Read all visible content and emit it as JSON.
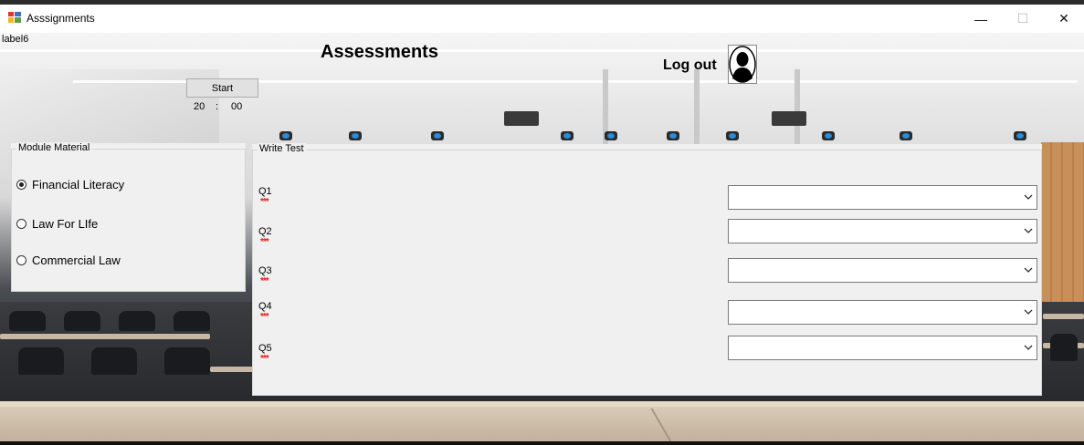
{
  "window": {
    "title": "Asssignments",
    "minimize_glyph": "—",
    "maximize_glyph": "☐",
    "close_glyph": "✕"
  },
  "label6": "label6",
  "heading": "Assessments",
  "logout": {
    "label": "Log out",
    "icon": "user-silhouette-icon"
  },
  "timer": {
    "start_label": "Start",
    "minutes": "20",
    "separator": ":",
    "seconds": "00"
  },
  "module_material": {
    "legend": "Module Material",
    "options": [
      {
        "label": "Financial Literacy",
        "checked": true
      },
      {
        "label": "Law For LIfe",
        "checked": false
      },
      {
        "label": "Commercial Law",
        "checked": false
      }
    ]
  },
  "write_test": {
    "legend": "Write Test",
    "questions": [
      {
        "label": "Q1",
        "required_marker": "***",
        "value": ""
      },
      {
        "label": "Q2",
        "required_marker": "***",
        "value": ""
      },
      {
        "label": "Q3",
        "required_marker": "***",
        "value": ""
      },
      {
        "label": "Q4",
        "required_marker": "***",
        "value": ""
      },
      {
        "label": "Q5",
        "required_marker": "***",
        "value": ""
      }
    ]
  },
  "colors": {
    "control_bg": "#f0f0f0",
    "required_marker": "#e02020",
    "button_bg": "#e1e1e1"
  }
}
